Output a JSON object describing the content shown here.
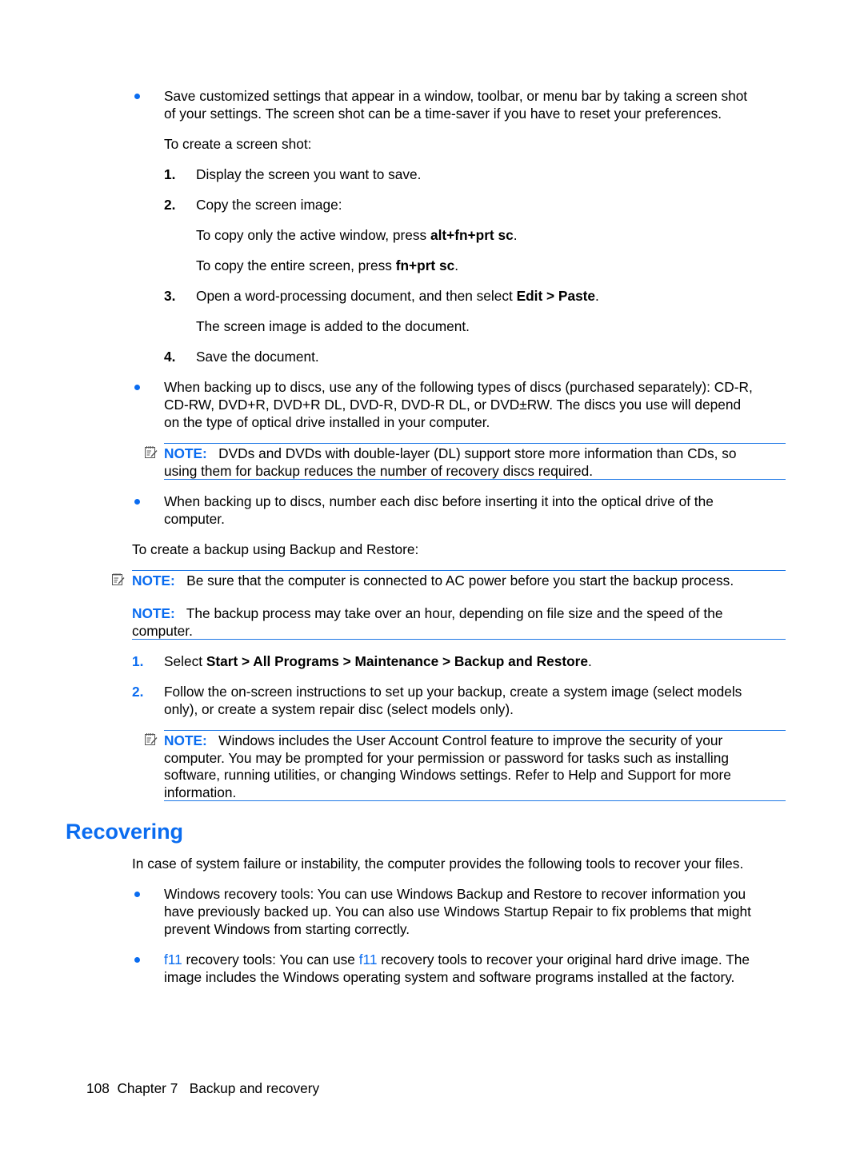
{
  "bullet1": {
    "line1": "Save customized settings that appear in a window, toolbar, or menu bar by taking a screen shot",
    "line2": "of your settings. The screen shot can be a time-saver if you have to reset your preferences.",
    "intro": "To create a screen shot:",
    "steps": [
      {
        "num": "1.",
        "text": "Display the screen you want to save."
      },
      {
        "num": "2.",
        "text": "Copy the screen image:"
      },
      {
        "num": "3.",
        "text_pre": "Open a word-processing document, and then select ",
        "text_bold": "Edit > Paste",
        "text_post": "."
      },
      {
        "num": "4.",
        "text": "Save the document."
      }
    ],
    "sub_active_pre": "To copy only the active window, press ",
    "sub_active_bold": "alt+fn+prt sc",
    "sub_active_post": ".",
    "sub_entire_pre": "To copy the entire screen, press ",
    "sub_entire_bold": "fn+prt sc",
    "sub_entire_post": ".",
    "step3_result": "The screen image is added to the document."
  },
  "bullet2": {
    "line1": "When backing up to discs, use any of the following types of discs (purchased separately): CD-R,",
    "line2": "CD-RW, DVD+R, DVD+R DL, DVD-R, DVD-R DL, or DVD±RW. The discs you use will depend",
    "line3": "on the type of optical drive installed in your computer."
  },
  "note_dl": {
    "label": "NOTE:",
    "line1": "DVDs and DVDs with double-layer (DL) support store more information than CDs, so",
    "line2": "using them for backup reduces the number of recovery discs required."
  },
  "bullet3": {
    "line1": "When backing up to discs, number each disc before inserting it into the optical drive of the",
    "line2": "computer."
  },
  "backup_intro": "To create a backup using Backup and Restore:",
  "note_ac": {
    "label": "NOTE:",
    "text": "Be sure that the computer is connected to AC power before you start the backup process."
  },
  "note_hour": {
    "label": "NOTE:",
    "line1": "The backup process may take over an hour, depending on file size and the speed of the",
    "line2": "computer."
  },
  "backup_steps": [
    {
      "num": "1.",
      "pre": "Select ",
      "bold": "Start > All Programs > Maintenance > Backup and Restore",
      "post": "."
    },
    {
      "num": "2.",
      "line1": "Follow the on-screen instructions to set up your backup, create a system image (select models",
      "line2": "only), or create a system repair disc (select models only)."
    }
  ],
  "note_uac": {
    "label": "NOTE:",
    "line1": "Windows includes the User Account Control feature to improve the security of your",
    "line2": "computer. You may be prompted for your permission or password for tasks such as installing",
    "line3": "software, running utilities, or changing Windows settings. Refer to Help and Support for more",
    "line4": "information."
  },
  "recovering": {
    "heading": "Recovering",
    "intro": "In case of system failure or instability, the computer provides the following tools to recover your files.",
    "item1": {
      "line1": "Windows recovery tools: You can use Windows Backup and Restore to recover information you",
      "line2": "have previously backed up. You can also use Windows Startup Repair to fix problems that might",
      "line3": "prevent Windows from starting correctly."
    },
    "item2": {
      "key1": "f11",
      "mid": " recovery tools: You can use ",
      "key2": "f11",
      "end": " recovery tools to recover your original hard drive image. The",
      "line2": "image includes the Windows operating system and software programs installed at the factory."
    }
  },
  "footer": {
    "page_number": "108",
    "chapter": "Chapter 7",
    "chapter_title": "Backup and recovery"
  },
  "colors": {
    "accent": "#0a6cf0",
    "rule": "#1e78e6",
    "text": "#000000"
  }
}
